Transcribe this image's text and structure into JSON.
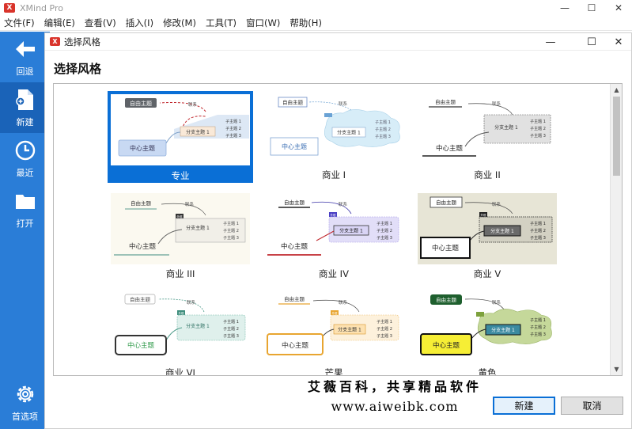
{
  "window": {
    "title": "XMind Pro",
    "logo": "X"
  },
  "menu": [
    "文件(F)",
    "编辑(E)",
    "查看(V)",
    "插入(I)",
    "修改(M)",
    "工具(T)",
    "窗口(W)",
    "帮助(H)"
  ],
  "sidebar": {
    "items": [
      {
        "label": "回退",
        "icon": "back-arrow-icon"
      },
      {
        "label": "新建",
        "icon": "new-file-icon"
      },
      {
        "label": "最近",
        "icon": "clock-icon"
      },
      {
        "label": "打开",
        "icon": "folder-icon"
      }
    ],
    "bottom": {
      "label": "首选项",
      "icon": "gear-icon"
    }
  },
  "dialog": {
    "title": "选择风格",
    "heading": "选择风格",
    "styles": [
      {
        "name": "专业",
        "selected": true
      },
      {
        "name": "商业 I"
      },
      {
        "name": "商业 II"
      },
      {
        "name": "商业 III"
      },
      {
        "name": "商业 IV"
      },
      {
        "name": "商业 V"
      },
      {
        "name": "商业 VI"
      },
      {
        "name": "芒果"
      },
      {
        "name": "黄色"
      }
    ],
    "thumb_text": {
      "central": "中心主题",
      "floating": "自由主题",
      "relation": "联系",
      "main": "分支主题 1",
      "sub1": "子主题 1",
      "sub2": "子主题 2",
      "sub3": "子主题 3",
      "tag": "外框"
    },
    "buttons": {
      "ok": "新建",
      "cancel": "取消"
    }
  },
  "watermark": {
    "line1": "艾薇百科，共享精品软件",
    "line2": "www.aiweibk.com"
  }
}
